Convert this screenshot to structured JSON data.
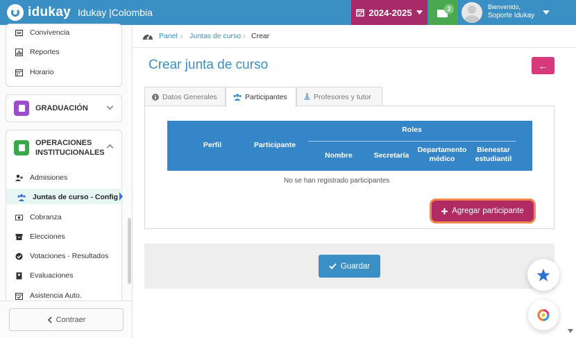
{
  "app": {
    "brand": "idukay",
    "separator": ":",
    "school": "Idukay |Colombia"
  },
  "topbar": {
    "year": "2024-2025",
    "mail_badge": "2",
    "greeting": "Bienvenido,",
    "user_name": "Soporte Idukay"
  },
  "sidebar": {
    "top_items": [
      {
        "label": "Convivencia",
        "icon": "id-card-icon"
      },
      {
        "label": "Reportes",
        "icon": "bar-chart-icon"
      },
      {
        "label": "Horario",
        "icon": "calendar-icon"
      }
    ],
    "graduation": {
      "label": "GRADUACIÓN",
      "icon": "document-icon",
      "color": "#9c4dcc"
    },
    "operations": {
      "label_line1": "OPERACIONES",
      "label_line2": "INSTITUCIONALES",
      "icon": "list-icon",
      "color": "#3aa84a"
    },
    "items": [
      {
        "label": "Admisiones",
        "icon": "user-plus-icon"
      },
      {
        "label": "Juntas de curso - Config",
        "icon": "users-icon"
      },
      {
        "label": "Cobranza",
        "icon": "money-icon"
      },
      {
        "label": "Elecciones",
        "icon": "archive-icon"
      },
      {
        "label": "Votaciones - Resultados",
        "icon": "check-circle-icon"
      },
      {
        "label": "Evaluaciones",
        "icon": "badge-icon"
      },
      {
        "label": "Asistencia Auto.",
        "icon": "calendar-check-icon"
      }
    ],
    "collapse_label": "Contraer"
  },
  "breadcrumb": {
    "panel": "Panel",
    "juntas": "Juntas de curso",
    "current": "Crear"
  },
  "page": {
    "title": "Crear junta de curso"
  },
  "tabs": [
    {
      "label": "Datos Generales",
      "icon": "info-icon"
    },
    {
      "label": "Participantes",
      "icon": "users-icon"
    },
    {
      "label": "Profesores y tutor",
      "icon": "flask-icon"
    }
  ],
  "table": {
    "perfil": "Perfil",
    "participante": "Participante",
    "roles": "Roles",
    "nombre": "Nombre",
    "secretaria": "Secretaría",
    "dep_medico_1": "Departamento",
    "dep_medico_2": "médico",
    "bienestar_1": "Bienestar",
    "bienestar_2": "estudiantil",
    "empty": "No se han registrado participantes"
  },
  "actions": {
    "add": "Agregar participante",
    "save": "Guardar"
  },
  "colors": {
    "primary": "#3a8fc4",
    "magenta": "#a72a6a",
    "green": "#4aa84f",
    "table": "#3586c9"
  }
}
